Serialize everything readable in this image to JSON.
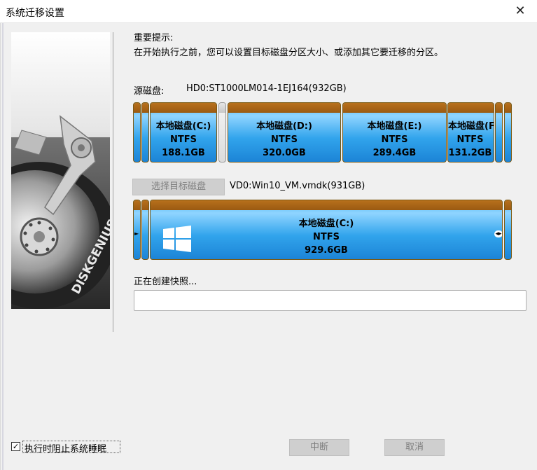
{
  "window": {
    "title": "系统迁移设置",
    "close_icon": "close-icon"
  },
  "sidebar": {
    "logo_text": "DISKGENIUS"
  },
  "notice": {
    "heading": "重要提示:",
    "text": "在开始执行之前，您可以设置目标磁盘分区大小、或添加其它要迁移的分区。"
  },
  "source": {
    "label": "源磁盘:",
    "disk_name": "HD0:ST1000LM014-1EJ164(932GB)",
    "partitions": [
      {
        "name": "本地磁盘(C:)",
        "fs": "NTFS",
        "size": "188.1GB"
      },
      {
        "name": "本地磁盘(D:)",
        "fs": "NTFS",
        "size": "320.0GB"
      },
      {
        "name": "本地磁盘(E:)",
        "fs": "NTFS",
        "size": "289.4GB"
      },
      {
        "name": "本地磁盘(F",
        "fs": "NTFS",
        "size": "131.2GB"
      }
    ]
  },
  "target": {
    "select_button": "选择目标磁盘",
    "disk_name": "VD0:Win10_VM.vmdk(931GB)",
    "partition": {
      "name": "本地磁盘(C:)",
      "fs": "NTFS",
      "size": "929.6GB",
      "icon": "windows-logo-icon"
    }
  },
  "status": {
    "text": "正在创建快照...",
    "progress": 0
  },
  "footer": {
    "checkbox_label": "执行时阻止系统睡眠",
    "checkbox_checked": true,
    "abort_button": "中断",
    "cancel_button": "取消"
  },
  "colors": {
    "partition_cap": "#a9661a",
    "partition_body": "#31a4ec"
  }
}
